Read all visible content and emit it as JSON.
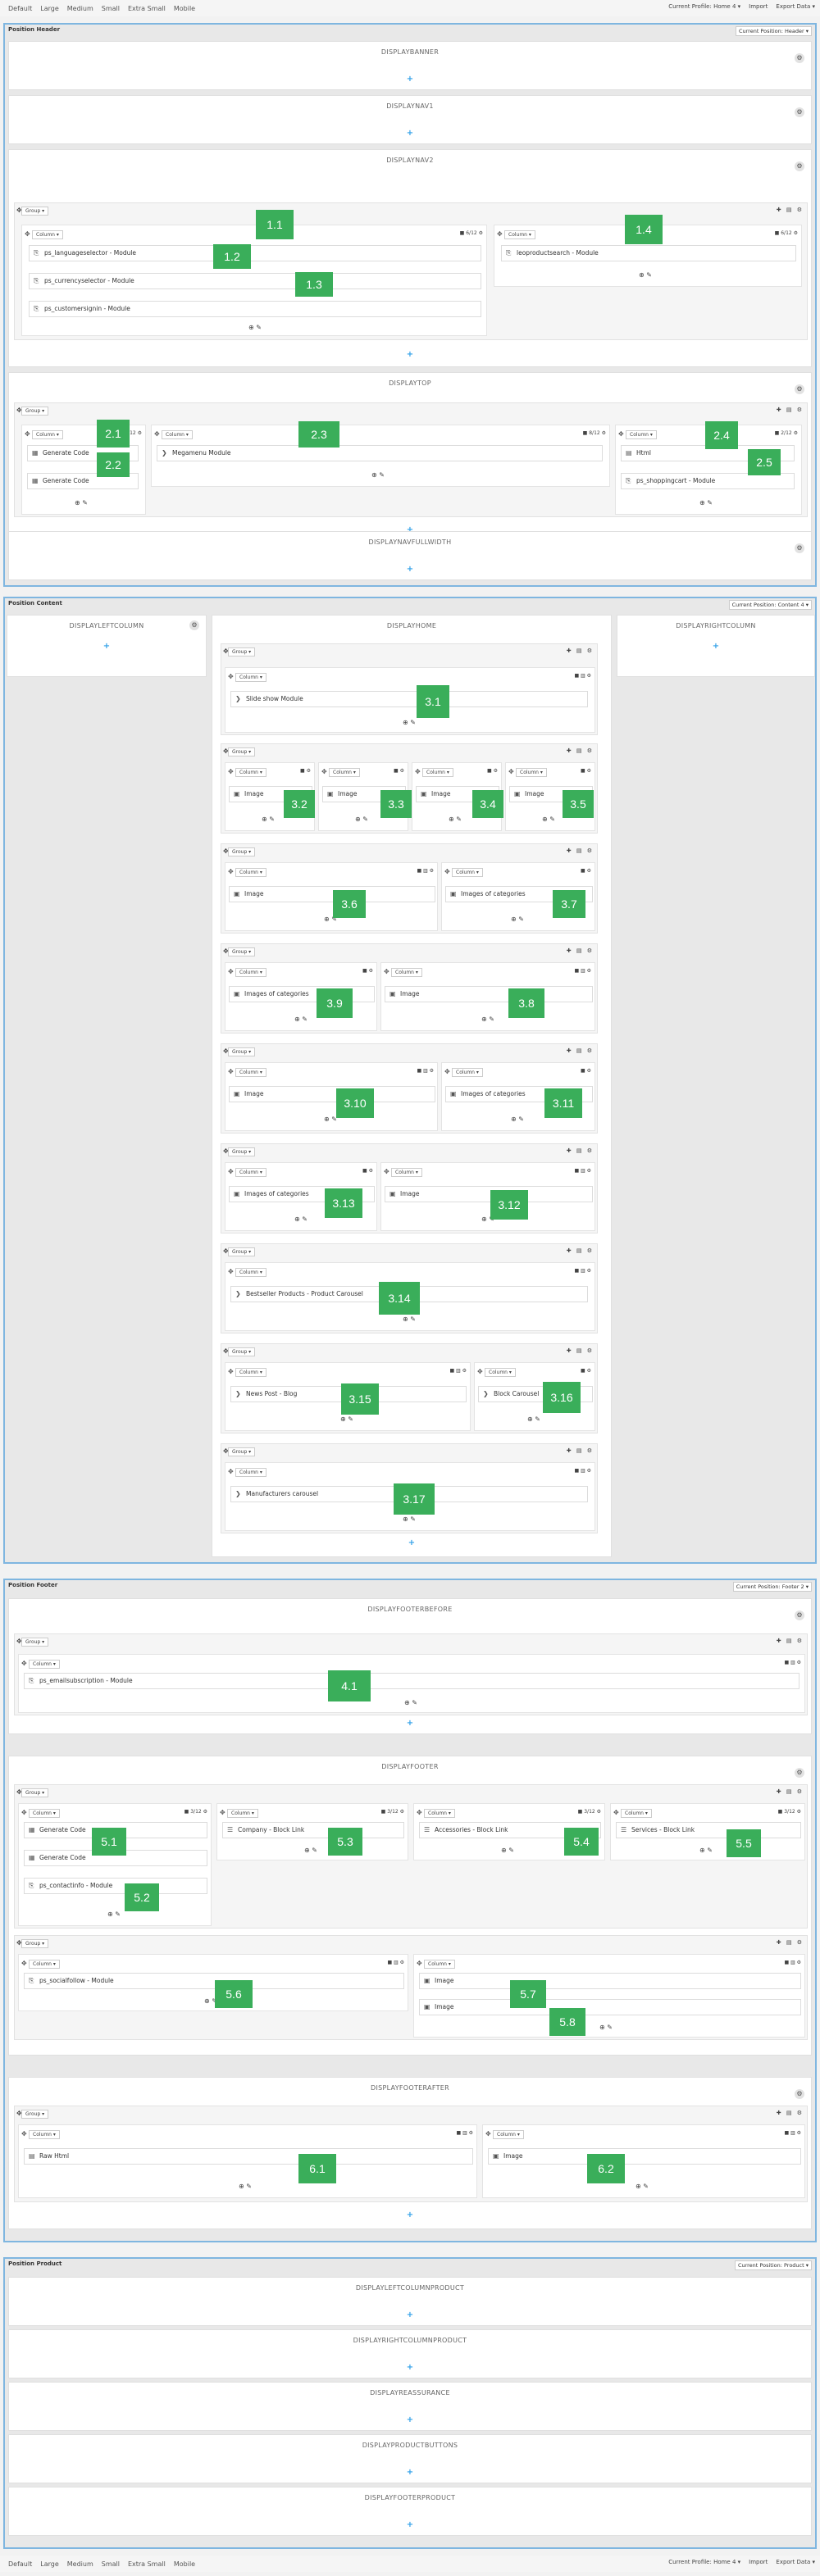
{
  "devices": [
    "Default",
    "Large",
    "Medium",
    "Small",
    "Extra Small",
    "Mobile"
  ],
  "toolbar": {
    "profile": "Current Profile: Home 4 ▾",
    "import": "Import",
    "export": "Export Data ▾"
  },
  "sections": {
    "header": {
      "title": "Position Header",
      "position": "Current Position: Header ▾"
    },
    "content": {
      "title": "Position Content",
      "position": "Current Position: Content 4 ▾"
    },
    "footer": {
      "title": "Position Footer",
      "position": "Current Position: Footer 2 ▾"
    },
    "product": {
      "title": "Position Product",
      "position": "Current Position: Product ▾"
    }
  },
  "hooks": {
    "displaybanner": "DISPLAYBANNER",
    "displaynav1": "DISPLAYNAV1",
    "displaynav2": "DISPLAYNAV2",
    "displaytop": "DISPLAYTOP",
    "displaynavfullwidth": "DISPLAYNAVFULLWIDTH",
    "displayleftcolumn": "DISPLAYLEFTCOLUMN",
    "displayhome": "DISPLAYHOME",
    "displayrightcolumn": "DISPLAYRIGHTCOLUMN",
    "displayfooterbefore": "DISPLAYFOOTERBEFORE",
    "displayfooter": "DISPLAYFOOTER",
    "displayfooterafter": "DISPLAYFOOTERAFTER",
    "displayleftcolumnproduct": "DISPLAYLEFTCOLUMNPRODUCT",
    "displayrightcolumnproduct": "DISPLAYRIGHTCOLUMNPRODUCT",
    "displayreassurance": "DISPLAYREASSURANCE",
    "displayproductbuttons": "DISPLAYPRODUCTBUTTONS",
    "displayfooterproduct": "DISPLAYFOOTERPRODUCT"
  },
  "labels": {
    "group": "Group ▾",
    "column": "Column ▾"
  },
  "modules": {
    "m1_1": "ps_languageselector - Module",
    "m1_2": "ps_currencyselector - Module",
    "m1_3": "ps_customersignin - Module",
    "m1_4": "leoproductsearch - Module",
    "m2_1": "Generate Code",
    "m2_2": "Generate Code",
    "m2_3": "Megamenu Module",
    "m2_4": "Html",
    "m2_5": "ps_shoppingcart - Module",
    "m3_1": "Slide show Module",
    "m3_2": "Image",
    "m3_3": "Image",
    "m3_4": "Image",
    "m3_5": "Image",
    "m3_6": "Image",
    "m3_7": "Images of categories",
    "m3_9": "Images of categories",
    "m3_8": "Image",
    "m3_10": "Image",
    "m3_11": "Images of categories",
    "m3_13": "Images of categories",
    "m3_12": "Image",
    "m3_14": "Bestseller Products - Product Carousel",
    "m3_15": "News Post - Blog",
    "m3_16": "Block Carousel",
    "m3_17": "Manufacturers carousel",
    "m4_1": "ps_emailsubscription - Module",
    "m5_1": "Generate Code",
    "m5_1b": "Generate Code",
    "m5_2": "ps_contactinfo - Module",
    "m5_3": "Company - Block Link",
    "m5_4": "Accessories - Block Link",
    "m5_5": "Services - Block Link",
    "m5_6": "ps_socialfollow - Module",
    "m5_7": "Image",
    "m5_8": "Image",
    "m6_1": "Raw Html",
    "m6_2": "Image"
  },
  "badges": {
    "b1_1": "1.1",
    "b1_2": "1.2",
    "b1_3": "1.3",
    "b1_4": "1.4",
    "b2_1": "2.1",
    "b2_2": "2.2",
    "b2_3": "2.3",
    "b2_4": "2.4",
    "b2_5": "2.5",
    "b3_1": "3.1",
    "b3_2": "3.2",
    "b3_3": "3.3",
    "b3_4": "3.4",
    "b3_5": "3.5",
    "b3_6": "3.6",
    "b3_7": "3.7",
    "b3_9": "3.9",
    "b3_8": "3.8",
    "b3_10": "3.10",
    "b3_11": "3.11",
    "b3_13": "3.13",
    "b3_12": "3.12",
    "b3_14": "3.14",
    "b3_15": "3.15",
    "b3_16": "3.16",
    "b3_17": "3.17",
    "b4_1": "4.1",
    "b5_1": "5.1",
    "b5_2": "5.2",
    "b5_3": "5.3",
    "b5_4": "5.4",
    "b5_5": "5.5",
    "b5_6": "5.6",
    "b5_7": "5.7",
    "b5_8": "5.8",
    "b6_1": "6.1",
    "b6_2": "6.2"
  },
  "colors": {
    "badge": "#3aae5a",
    "add": "#2fa0e8",
    "section_border": "#7fb6e0"
  }
}
